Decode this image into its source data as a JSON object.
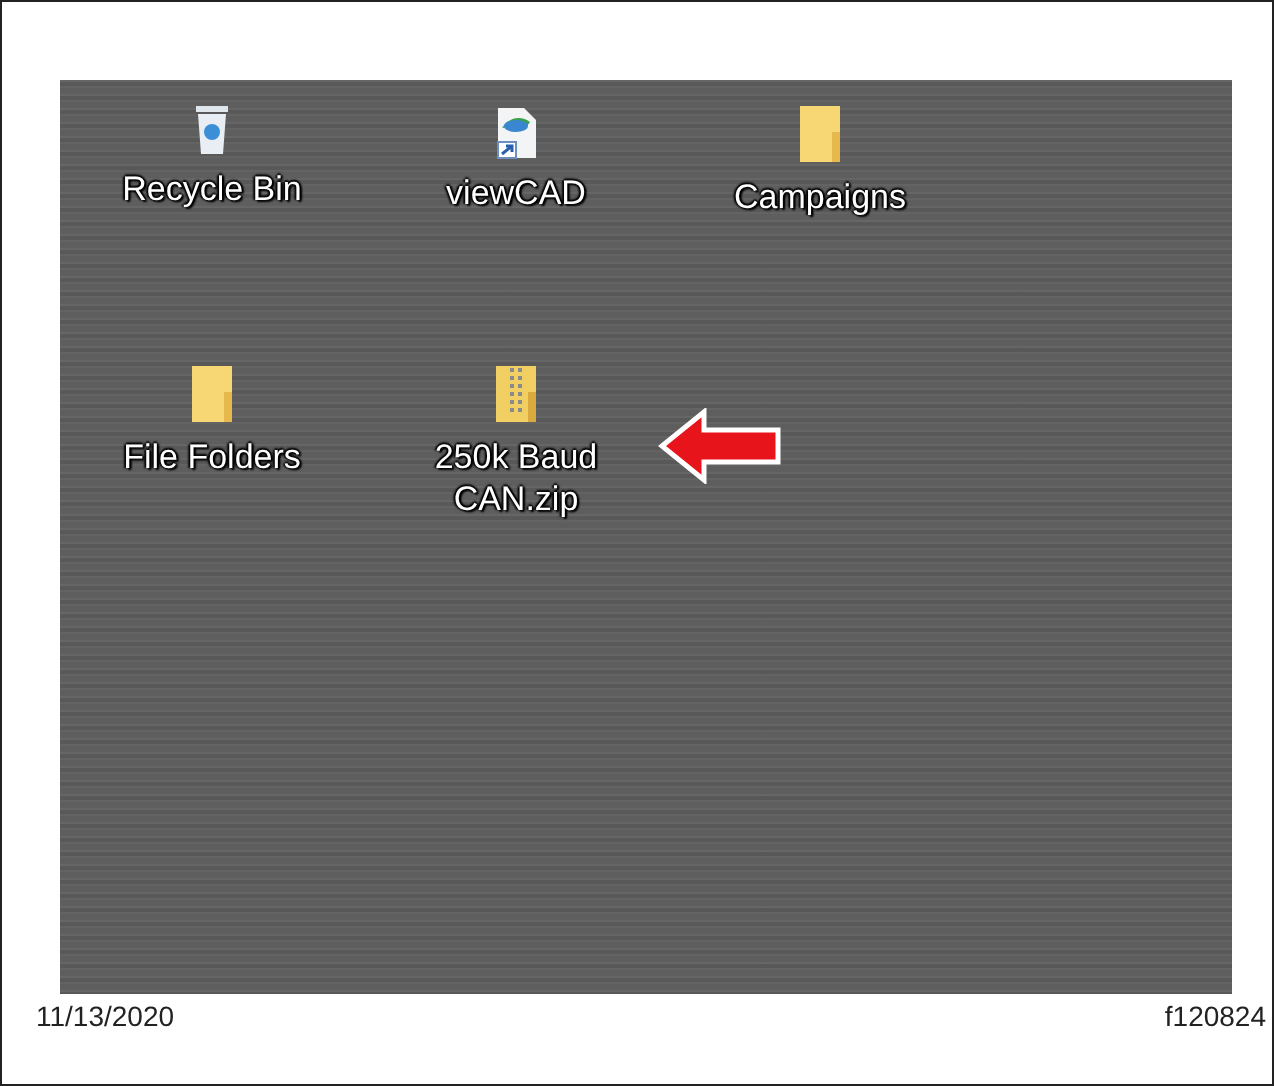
{
  "desktop": {
    "icons": [
      {
        "kind": "recycle-bin",
        "label": "Recycle Bin",
        "marked": false
      },
      {
        "kind": "shortcut",
        "label": "viewCAD",
        "marked": false
      },
      {
        "kind": "folder",
        "label": "Campaigns",
        "marked": false
      },
      {
        "kind": "folder",
        "label": "File Folders",
        "marked": false
      },
      {
        "kind": "zip",
        "label": "250k Baud CAN.zip",
        "marked": true
      }
    ]
  },
  "footer": {
    "date": "11/13/2020",
    "figure_id": "f120824"
  }
}
